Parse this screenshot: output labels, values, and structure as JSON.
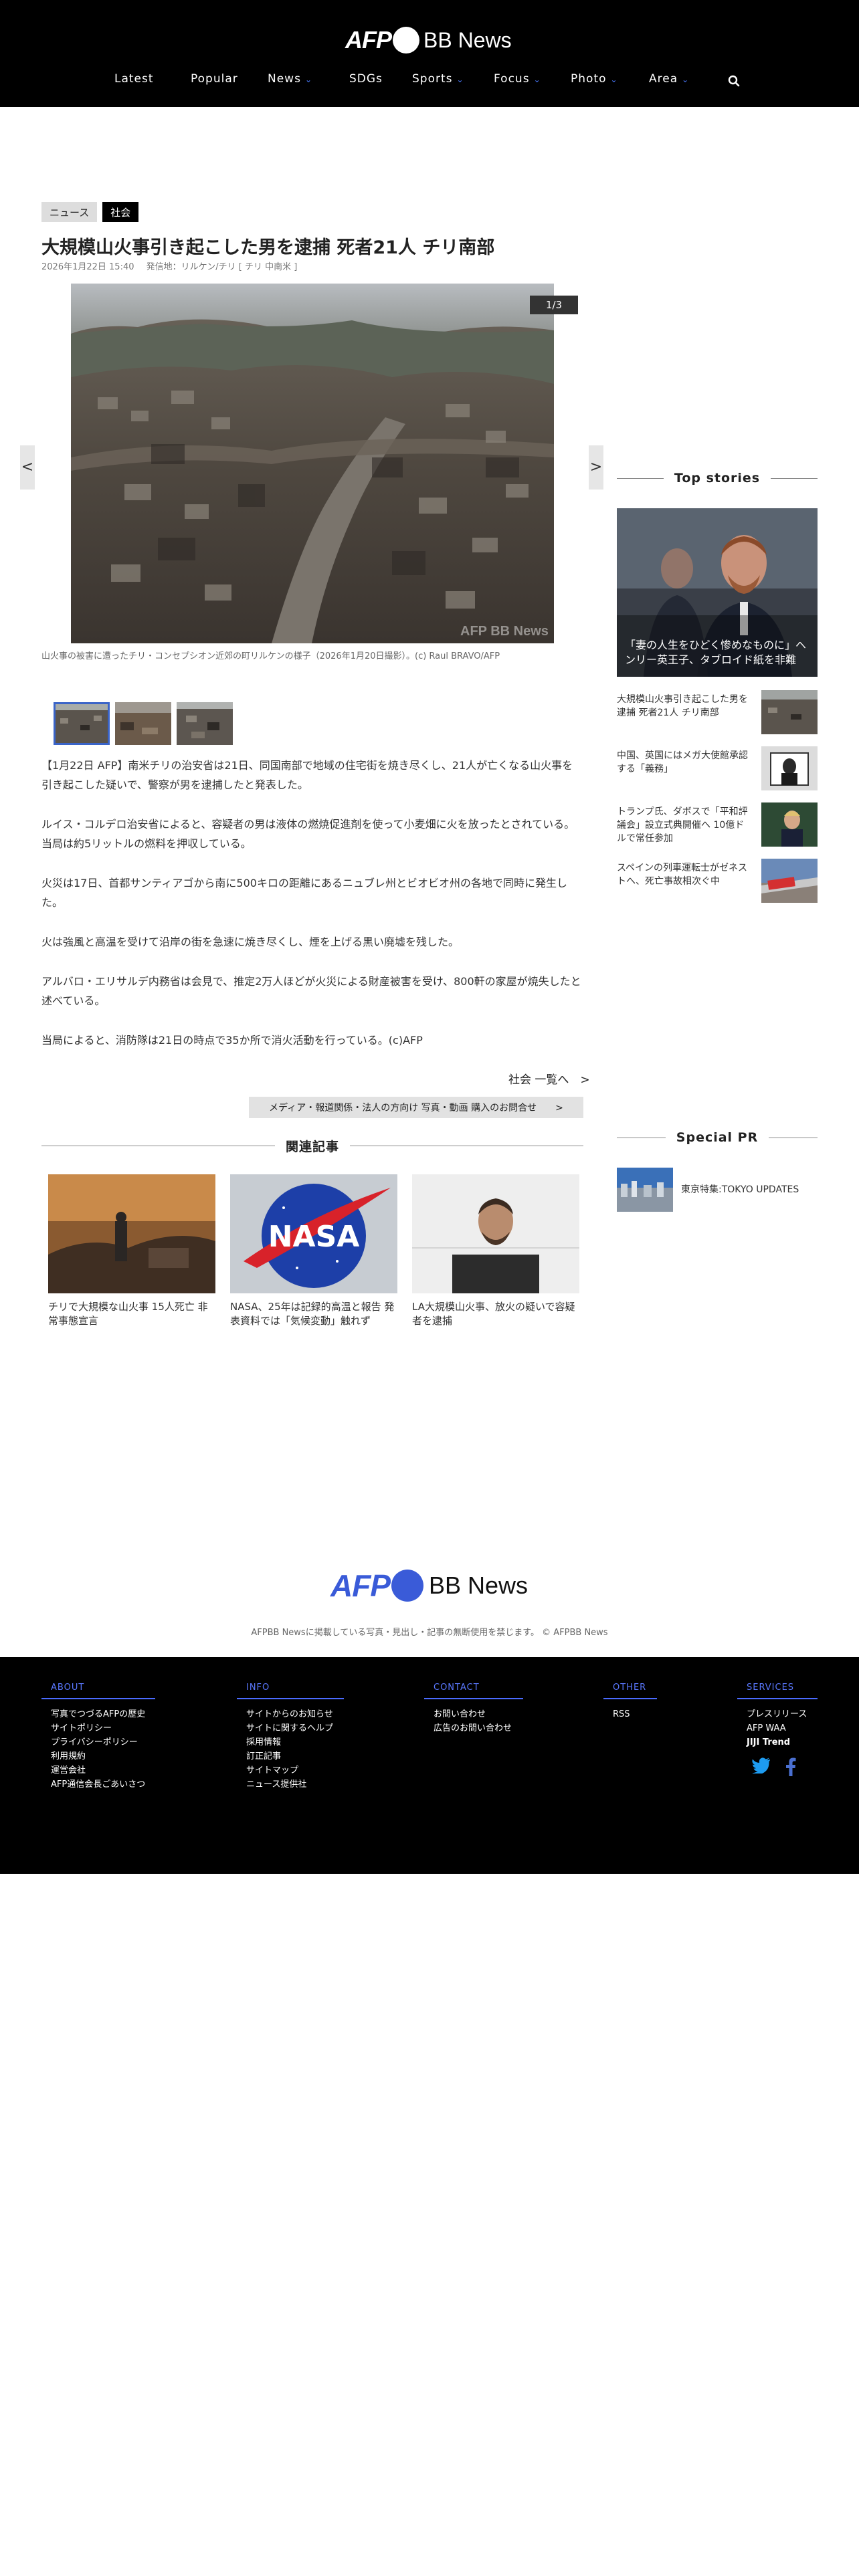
{
  "header": {
    "logo_afp": "AFP",
    "logo_bb": "BB News",
    "nav": [
      {
        "label": "Latest",
        "dropdown": false
      },
      {
        "label": "Popular",
        "dropdown": false
      },
      {
        "label": "News",
        "dropdown": true
      },
      {
        "label": "SDGs",
        "dropdown": false
      },
      {
        "label": "Sports",
        "dropdown": true
      },
      {
        "label": "Focus",
        "dropdown": true
      },
      {
        "label": "Photo",
        "dropdown": true
      },
      {
        "label": "Area",
        "dropdown": true
      }
    ],
    "search_icon": "search-icon"
  },
  "article": {
    "tags": [
      "ニュース",
      "社会"
    ],
    "title": "大規模山火事引き起こした男を逮捕 死者21人 チリ南部",
    "date": "2026年1月22日 15:40",
    "location": "発信地：リルケン/チリ [ チリ 中南米 ]",
    "slide_counter": "1/3",
    "prev_label": "<",
    "next_label": ">",
    "watermark": "AFP BB News",
    "caption": "山火事の被害に遭ったチリ・コンセプシオン近郊の町リルケンの様子（2026年1月20日撮影）。(c) Raul BRAVO/AFP",
    "paragraphs": [
      "【1月22日 AFP】南米チリの治安省は21日、同国南部で地域の住宅街を焼き尽くし、21人が亡くなる山火事を引き起こした疑いで、警察が男を逮捕したと発表した。",
      "ルイス・コルデロ治安省によると、容疑者の男は液体の燃焼促進剤を使って小麦畑に火を放ったとされている。当局は約5リットルの燃料を押収している。",
      "火災は17日、首都サンティアゴから南に500キロの距離にあるニュブレ州とビオビオ州の各地で同時に発生した。",
      "火は強風と高温を受けて沿岸の街を急速に焼き尽くし、煙を上げる黒い廃墟を残した。",
      "アルバロ・エリサルデ内務省は会見で、推定2万人ほどが火災による財産被害を受け、800軒の家屋が焼失したと述べている。",
      "当局によると、消防隊は21日の時点で35か所で消火活動を行っている。(c)AFP"
    ],
    "more_link": "社会 一覧へ　>",
    "media_button": "メディア・報道関係・法人の方向け 写真・動画 購入のお問合せ　　>"
  },
  "related": {
    "heading": "関連記事",
    "items": [
      "チリで大規模な山火事 15人死亡 非常事態宣言",
      "NASA、25年は記録的高温と報告 発表資料では「気候変動」触れず",
      "LA大規模山火事、放火の疑いで容疑者を逮捕"
    ]
  },
  "sidebar": {
    "top_heading": "Top stories",
    "top_main": "「妻の人生をひどく惨めなものに」ヘンリー英王子、タブロイド紙を非難",
    "stories": [
      "大規模山火事引き起こした男を逮捕 死者21人 チリ南部",
      "中国、英国にはメガ大使館承認する「義務」",
      "トランプ氏、ダボスで「平和評議会」設立式典開催へ 10億ドルで常任参加",
      "スペインの列車運転士がゼネストへ、死亡事故相次ぐ中"
    ],
    "pr_heading": "Special PR",
    "pr_item": "東京特集:TOKYO UPDATES"
  },
  "footer": {
    "copyright": "AFPBB Newsに掲載している写真・見出し・記事の無断使用を禁じます。 © AFPBB News",
    "columns": [
      {
        "head": "ABOUT",
        "items": [
          "写真でつづるAFPの歴史",
          "サイトポリシー",
          "プライバシーポリシー",
          "利用規約",
          "運営会社",
          "AFP通信会長ごあいさつ"
        ]
      },
      {
        "head": "INFO",
        "items": [
          "サイトからのお知らせ",
          "サイトに関するヘルプ",
          "採用情報",
          "訂正記事",
          "サイトマップ",
          "ニュース提供社"
        ]
      },
      {
        "head": "CONTACT",
        "items": [
          "お問い合わせ",
          "広告のお問い合わせ"
        ]
      },
      {
        "head": "OTHER",
        "items": [
          "RSS"
        ]
      },
      {
        "head": "SERVICES",
        "items": [
          "プレスリリース",
          "AFP WAA"
        ]
      }
    ],
    "jiji": "JIJI Trend",
    "colors": {
      "accent": "#4a6bff",
      "logo_blue": "#3a5bd8"
    }
  }
}
